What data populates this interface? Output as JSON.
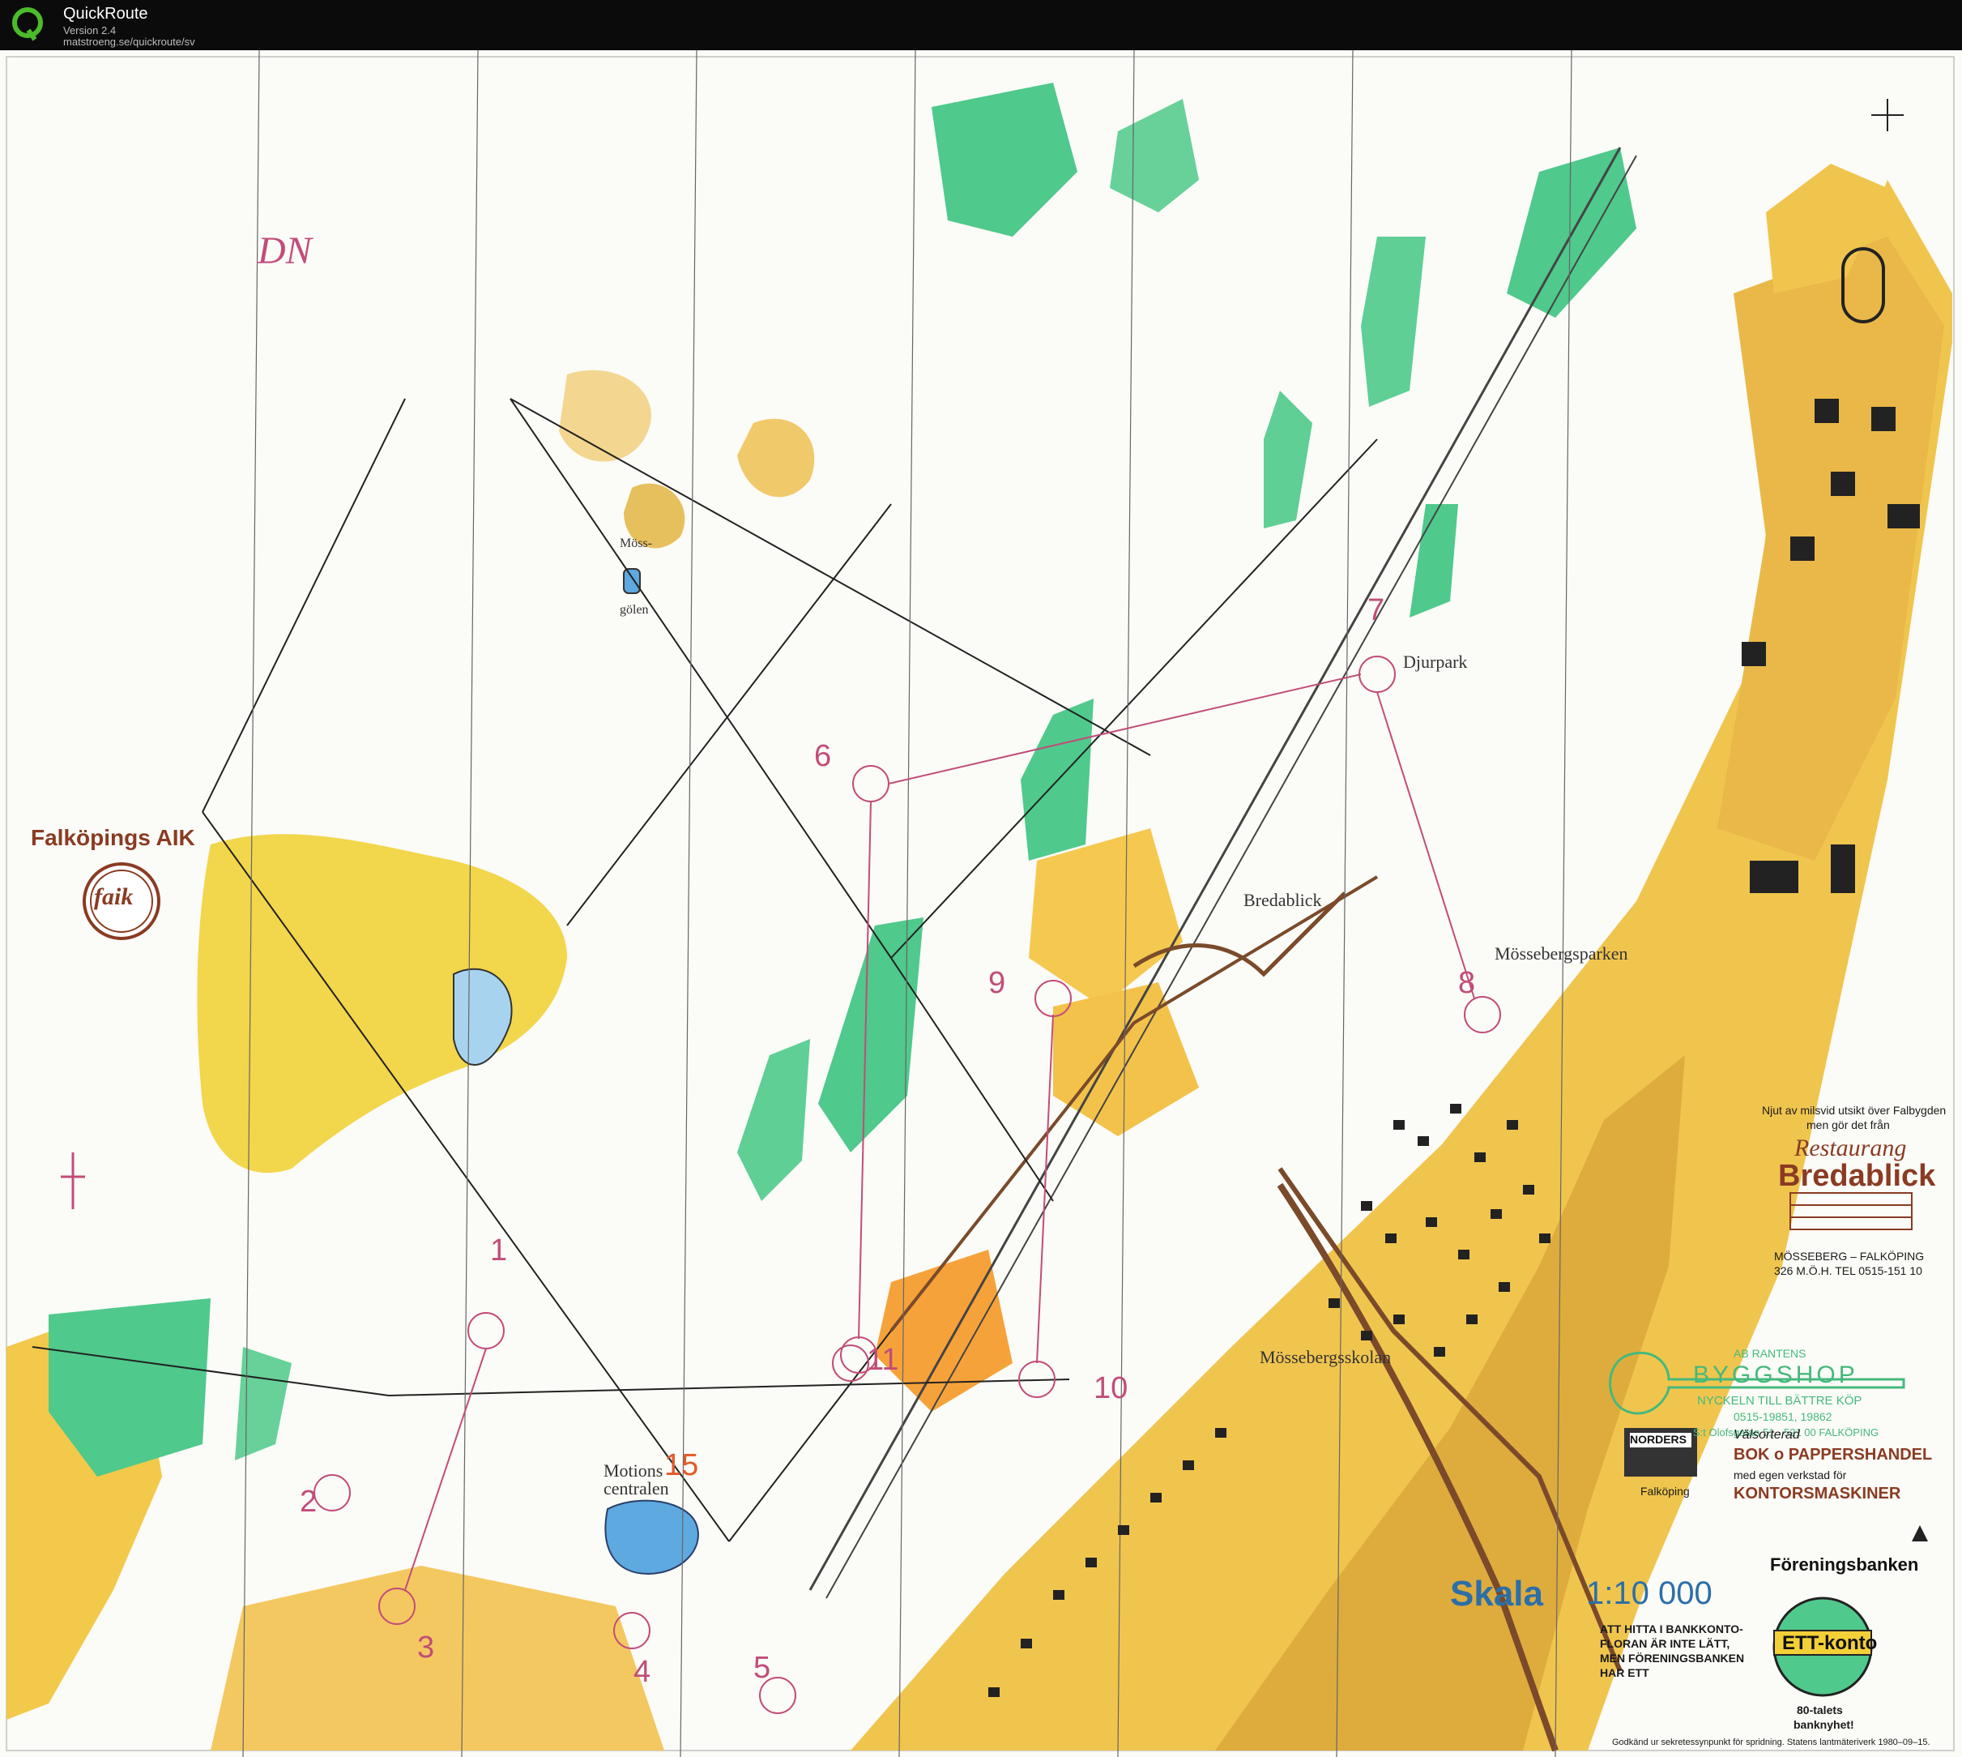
{
  "app": {
    "name": "QuickRoute",
    "version": "Version 2.4",
    "url": "matstroeng.se/quickroute/sv"
  },
  "map": {
    "annotation": "DN",
    "club": "Falköpings AIK",
    "club_logo_text": "faik",
    "place_names": {
      "moss_golen_1": "Möss-",
      "moss_golen_2": "gölen",
      "djurpark": "Djurpark",
      "bredablick": "Bredablick",
      "mossebergsparken": "Mössebergsparken",
      "mossebergsskolan": "Mössebergsskolan",
      "motions_1": "Motions",
      "motions_2": "centralen"
    },
    "controls": [
      {
        "n": "1"
      },
      {
        "n": "2"
      },
      {
        "n": "3"
      },
      {
        "n": "4"
      },
      {
        "n": "5"
      },
      {
        "n": "6"
      },
      {
        "n": "7"
      },
      {
        "n": "8"
      },
      {
        "n": "9"
      },
      {
        "n": "10"
      },
      {
        "n": "11"
      },
      {
        "n": "15"
      }
    ],
    "scale_label": "Skala",
    "scale_value": "1:10 000",
    "ads": {
      "restaurang": {
        "line1": "Njut av milsvid utsikt över Falbygden",
        "line2": "men gör det från",
        "script": "Restaurang",
        "name": "Bredablick",
        "addr1": "MÖSSEBERG – FALKÖPING",
        "addr2": "326 M.Ö.H. TEL 0515-151 10"
      },
      "byggshop": {
        "top": "AB RANTENS",
        "name": "BYGGSHOP",
        "slogan": "NYCKELN TILL BÄTTRE KÖP",
        "phone": "0515-19851, 19862",
        "addr": "S:t Olofsgatan 51 · 521 00 FALKÖPING"
      },
      "norders": {
        "name": "NORDERS",
        "town": "Falköping",
        "valsorterad": "Välsorterad",
        "line1": "BOK o PAPPERSHANDEL",
        "line2": "med egen verkstad för",
        "line3": "KONTORSMASKINER"
      },
      "foreningsbanken": {
        "name": "Föreningsbanken",
        "line1": "ATT HITTA I BANKKONTO-",
        "line2": "FLORAN ÄR INTE LÄTT,",
        "line3": "MEN FÖRENINGSBANKEN",
        "line4": "HAR ETT",
        "ett": "ETT-konto",
        "slogan1": "80-talets",
        "slogan2": "banknyhet!"
      }
    },
    "footer": "Godkänd ur sekretessynpunkt för spridning. Statens lantmäteriverk 1980–09–15."
  },
  "colors": {
    "open": "#f3c24b",
    "rough": "#f7dc8a",
    "green": "#4fc98c",
    "urban": "#d9a53a",
    "course": "#c14d79",
    "water": "#5ea9e0",
    "road": "#7a4a2a"
  }
}
